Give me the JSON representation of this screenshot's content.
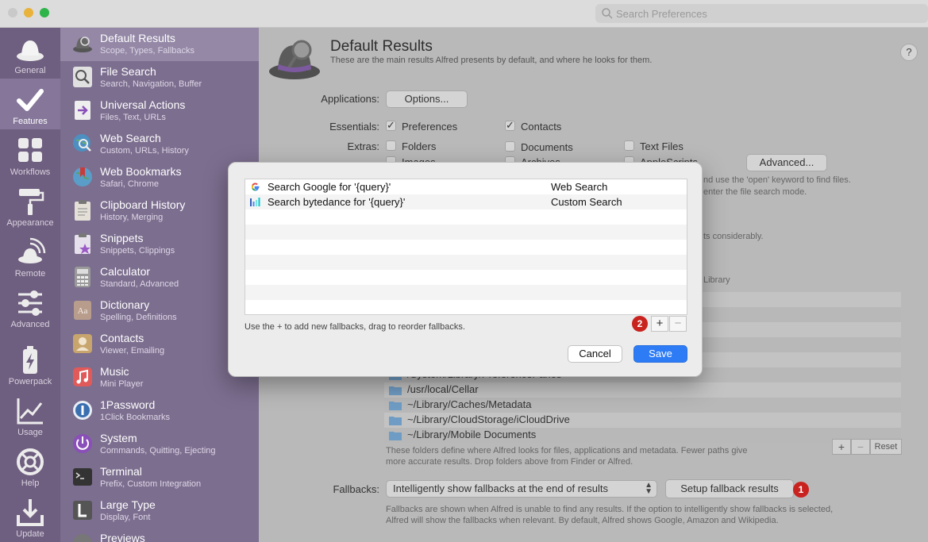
{
  "window": {
    "search_placeholder": "Search Preferences"
  },
  "rail": {
    "items": [
      {
        "label": "General",
        "icon": "hat-icon"
      },
      {
        "label": "Features",
        "icon": "checkmark-icon"
      },
      {
        "label": "Workflows",
        "icon": "grid-icon"
      },
      {
        "label": "Appearance",
        "icon": "paint-roller-icon"
      },
      {
        "label": "Remote",
        "icon": "remote-icon"
      },
      {
        "label": "Advanced",
        "icon": "sliders-icon"
      },
      {
        "label": "Powerpack",
        "icon": "battery-bolt-icon"
      },
      {
        "label": "Usage",
        "icon": "chart-icon"
      },
      {
        "label": "Help",
        "icon": "lifebuoy-icon"
      },
      {
        "label": "Update",
        "icon": "download-icon"
      }
    ],
    "selected": "Features"
  },
  "features": {
    "items": [
      {
        "title": "Default Results",
        "subtitle": "Scope, Types, Fallbacks",
        "color": "#6b6b6b"
      },
      {
        "title": "File Search",
        "subtitle": "Search, Navigation, Buffer",
        "color": "#d9d9d9"
      },
      {
        "title": "Universal Actions",
        "subtitle": "Files, Text, URLs",
        "color": "#e6e6e6"
      },
      {
        "title": "Web Search",
        "subtitle": "Custom, URLs, History",
        "color": "#4c8fc0"
      },
      {
        "title": "Web Bookmarks",
        "subtitle": "Safari, Chrome",
        "color": "#5aa06b"
      },
      {
        "title": "Clipboard History",
        "subtitle": "History, Merging",
        "color": "#e4e0d8"
      },
      {
        "title": "Snippets",
        "subtitle": "Snippets, Clippings",
        "color": "#d8c9e8"
      },
      {
        "title": "Calculator",
        "subtitle": "Standard, Advanced",
        "color": "#8b8b8b"
      },
      {
        "title": "Dictionary",
        "subtitle": "Spelling, Definitions",
        "color": "#b89d8c"
      },
      {
        "title": "Contacts",
        "subtitle": "Viewer, Emailing",
        "color": "#c7a56d"
      },
      {
        "title": "Music",
        "subtitle": "Mini Player",
        "color": "#e05a5a"
      },
      {
        "title": "1Password",
        "subtitle": "1Click Bookmarks",
        "color": "#3a6fb0"
      },
      {
        "title": "System",
        "subtitle": "Commands, Quitting, Ejecting",
        "color": "#8a4fb8"
      },
      {
        "title": "Terminal",
        "subtitle": "Prefix, Custom Integration",
        "color": "#333333"
      },
      {
        "title": "Large Type",
        "subtitle": "Display, Font",
        "color": "#555555"
      },
      {
        "title": "Previews",
        "subtitle": "",
        "color": "#666666"
      }
    ],
    "selected": "Default Results"
  },
  "main": {
    "title": "Default Results",
    "subtitle": "These are the main results Alfred presents by default, and where he looks for them.",
    "help": "?",
    "applications_label": "Applications:",
    "options_button": "Options...",
    "essentials_label": "Essentials:",
    "essentials": [
      {
        "label": "Preferences",
        "checked": true
      },
      {
        "label": "Contacts",
        "checked": true
      }
    ],
    "extras_label": "Extras:",
    "extras_row1": [
      {
        "label": "Folders",
        "checked": false
      },
      {
        "label": "Documents",
        "checked": false
      },
      {
        "label": "Text Files",
        "checked": false
      }
    ],
    "extras_row2": [
      {
        "label": "Images",
        "checked": false
      },
      {
        "label": "Archives",
        "checked": false
      },
      {
        "label": "AppleScripts",
        "checked": false
      }
    ],
    "advanced_button": "Advanced...",
    "extras_note_1": "nd use the 'open' keyword to find files.",
    "extras_note_2": "enter the file search mode.",
    "perf_note": "ts considerably.",
    "library_note": "Library",
    "scope_paths": [
      "/System/Library/PreferencePanes",
      "/usr/local/Cellar",
      "~/Library/Caches/Metadata",
      "~/Library/CloudStorage/iCloudDrive",
      "~/Library/Mobile Documents"
    ],
    "scope_add": "+",
    "scope_remove": "−",
    "scope_reset": "Reset",
    "scope_note_1": "These folders define where Alfred looks for files, applications and metadata. Fewer paths give",
    "scope_note_2": "more accurate results. Drop folders above from Finder or Alfred.",
    "fallbacks_label": "Fallbacks:",
    "fallbacks_select": "Intelligently show fallbacks at the end of results",
    "setup_fallback_button": "Setup fallback results",
    "fallback_note_1": "Fallbacks are shown when Alfred is unable to find any results. If the option to intelligently show fallbacks is selected,",
    "fallback_note_2": "Alfred will show the fallbacks when relevant. By default, Alfred shows Google, Amazon and Wikipedia.",
    "badge_1": "1"
  },
  "modal": {
    "rows": [
      {
        "title": "Search Google for '{query}'",
        "type": "Web Search",
        "icon": "google-icon"
      },
      {
        "title": "Search bytedance for '{query}'",
        "type": "Custom Search",
        "icon": "bytedance-icon"
      }
    ],
    "hint": "Use the + to add new fallbacks, drag to reorder fallbacks.",
    "add": "+",
    "remove": "−",
    "badge_2": "2",
    "cancel": "Cancel",
    "save": "Save"
  },
  "colors": {
    "rail_bg": "#6e5e7f",
    "list_bg": "#7c6e8f",
    "accent": "#2d7cf6",
    "badge": "#c9231f"
  }
}
